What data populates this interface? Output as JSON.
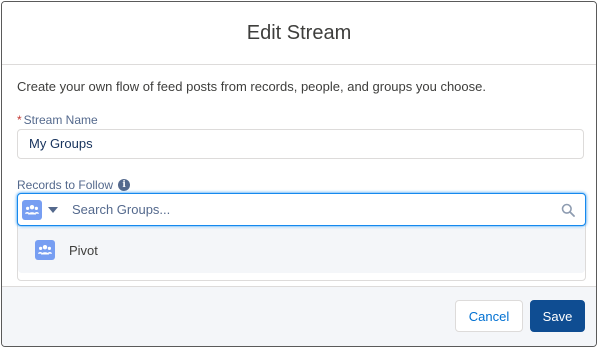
{
  "modal": {
    "title": "Edit Stream",
    "description": "Create your own flow of feed posts from records, people, and groups you choose."
  },
  "stream_name": {
    "required_marker": "*",
    "label": "Stream Name",
    "value": "My Groups"
  },
  "records_to_follow": {
    "label": "Records to Follow",
    "info_icon": "info-icon",
    "lookup_icon": "groups-icon",
    "search_placeholder": "Search Groups...",
    "options": [
      {
        "label": "Pivot",
        "icon": "groups-icon"
      }
    ]
  },
  "footer": {
    "cancel_label": "Cancel",
    "save_label": "Save"
  },
  "colors": {
    "brand_button": "#0f4d92",
    "focus_border": "#1589ee",
    "group_icon_bg": "#779ef2",
    "required": "#c23934"
  }
}
